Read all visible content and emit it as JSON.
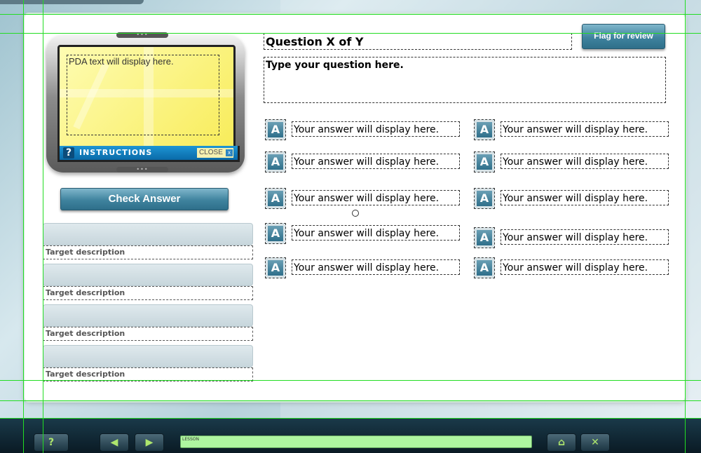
{
  "pda": {
    "text": "PDA text will display here.",
    "instructions": "INSTRUCTIONS",
    "close": "CLOSE",
    "close_icon": "x-icon",
    "help_icon": "?"
  },
  "check_answer": "Check Answer",
  "flag_review": "Flag for review",
  "question": {
    "title": "Question X of Y",
    "text": "Type your question here."
  },
  "targets": [
    {
      "desc": "Target description"
    },
    {
      "desc": "Target description"
    },
    {
      "desc": "Target description"
    },
    {
      "desc": "Target description"
    }
  ],
  "answers": [
    {
      "icon": "A",
      "text": "Your answer will display here."
    },
    {
      "icon": "A",
      "text": "Your answer will display here."
    },
    {
      "icon": "A",
      "text": "Your answer will display here."
    },
    {
      "icon": "A",
      "text": "Your answer will display here."
    },
    {
      "icon": "A",
      "text": "Your answer will display here."
    },
    {
      "icon": "A",
      "text": "Your answer will display here."
    },
    {
      "icon": "A",
      "text": "Your answer will display here."
    },
    {
      "icon": "A",
      "text": "Your answer will display here."
    },
    {
      "icon": "A",
      "text": "Your answer will display here."
    },
    {
      "icon": "A",
      "text": "Your answer will display here."
    }
  ],
  "footer": {
    "help": "?",
    "prev": "◀",
    "next": "▶",
    "lesson": "LESSON",
    "home": "⌂",
    "exit": "✕"
  }
}
